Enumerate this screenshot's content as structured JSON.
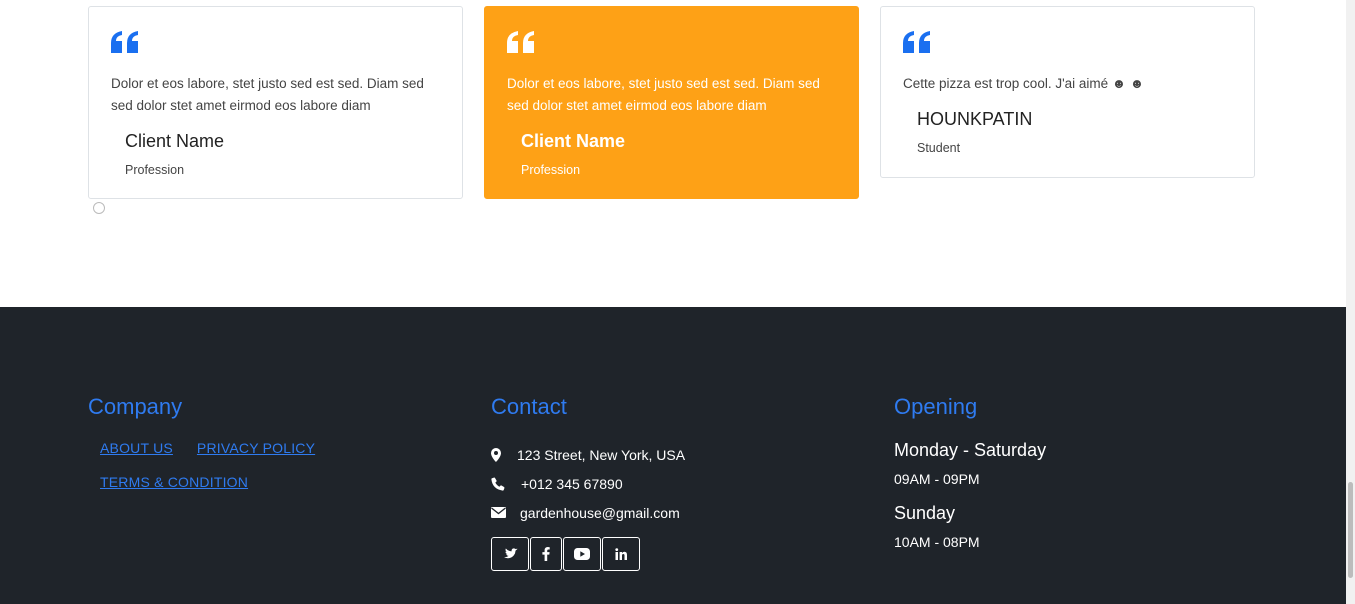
{
  "testimonials": [
    {
      "text": "Dolor et eos labore, stet justo sed est sed. Diam sed sed dolor stet amet eirmod eos labore diam",
      "name": "Client Name",
      "profession": "Profession"
    },
    {
      "text": "Dolor et eos labore, stet justo sed est sed. Diam sed sed dolor stet amet eirmod eos labore diam",
      "name": "Client Name",
      "profession": "Profession"
    },
    {
      "text": "Cette pizza est trop cool. J'ai aimé ☻ ☻",
      "name": "HOUNKPATIN",
      "profession": "Student"
    }
  ],
  "colors": {
    "accent": "#fea116",
    "primary": "#2f7bf0",
    "footer_bg": "#1f242a"
  },
  "footer": {
    "company": {
      "title": "Company",
      "links": [
        "ABOUT US",
        "PRIVACY POLICY",
        "TERMS & CONDITION"
      ]
    },
    "contact": {
      "title": "Contact",
      "address": "123 Street, New York, USA",
      "phone": "+012 345 67890",
      "email": "gardenhouse@gmail.com",
      "social": [
        "twitter-icon",
        "facebook-icon",
        "youtube-icon",
        "linkedin-icon"
      ]
    },
    "opening": {
      "title": "Opening",
      "day1": "Monday - Saturday",
      "hours1": "09AM - 09PM",
      "day2": "Sunday",
      "hours2": "10AM - 08PM"
    }
  }
}
